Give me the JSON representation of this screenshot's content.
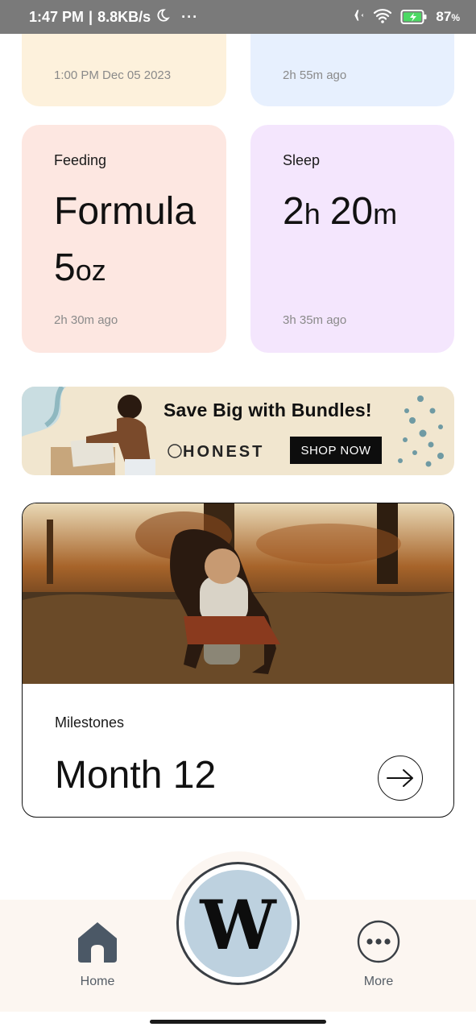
{
  "status_bar": {
    "time": "1:47 PM",
    "speed": "8.8KB/s",
    "more": "···",
    "battery_pct": "87",
    "battery_unit": "%"
  },
  "cards": {
    "top_left": {
      "ago": "1:00 PM Dec 05 2023"
    },
    "top_right": {
      "ago": "2h 55m ago"
    },
    "feeding": {
      "label": "Feeding",
      "value": "Formula",
      "amount": "5",
      "amount_unit": "oz",
      "ago": "2h 30m ago"
    },
    "sleep": {
      "label": "Sleep",
      "hours": "2",
      "hours_unit": "h",
      "minutes": "20",
      "minutes_unit": "m",
      "ago": "3h 35m ago"
    }
  },
  "ad": {
    "title": "Save Big with Bundles!",
    "brand": "HONEST",
    "cta": "SHOP NOW"
  },
  "milestone": {
    "label": "Milestones",
    "value": "Month 12"
  },
  "nav": {
    "home": "Home",
    "more": "More",
    "center_letter": "W"
  },
  "colors": {
    "feeding_bg": "#fde7e1",
    "sleep_bg": "#f4e6fd",
    "top_left_bg": "#fdf1dc",
    "top_right_bg": "#e7f0fe",
    "nav_bg": "#fcf6f1",
    "center_button": "#bdd1df",
    "nav_icon": "#4b5866"
  },
  "icons": [
    "moon-icon",
    "airplane-icon",
    "wifi-icon",
    "battery-icon",
    "home-icon",
    "more-icon",
    "arrow-right-icon"
  ]
}
